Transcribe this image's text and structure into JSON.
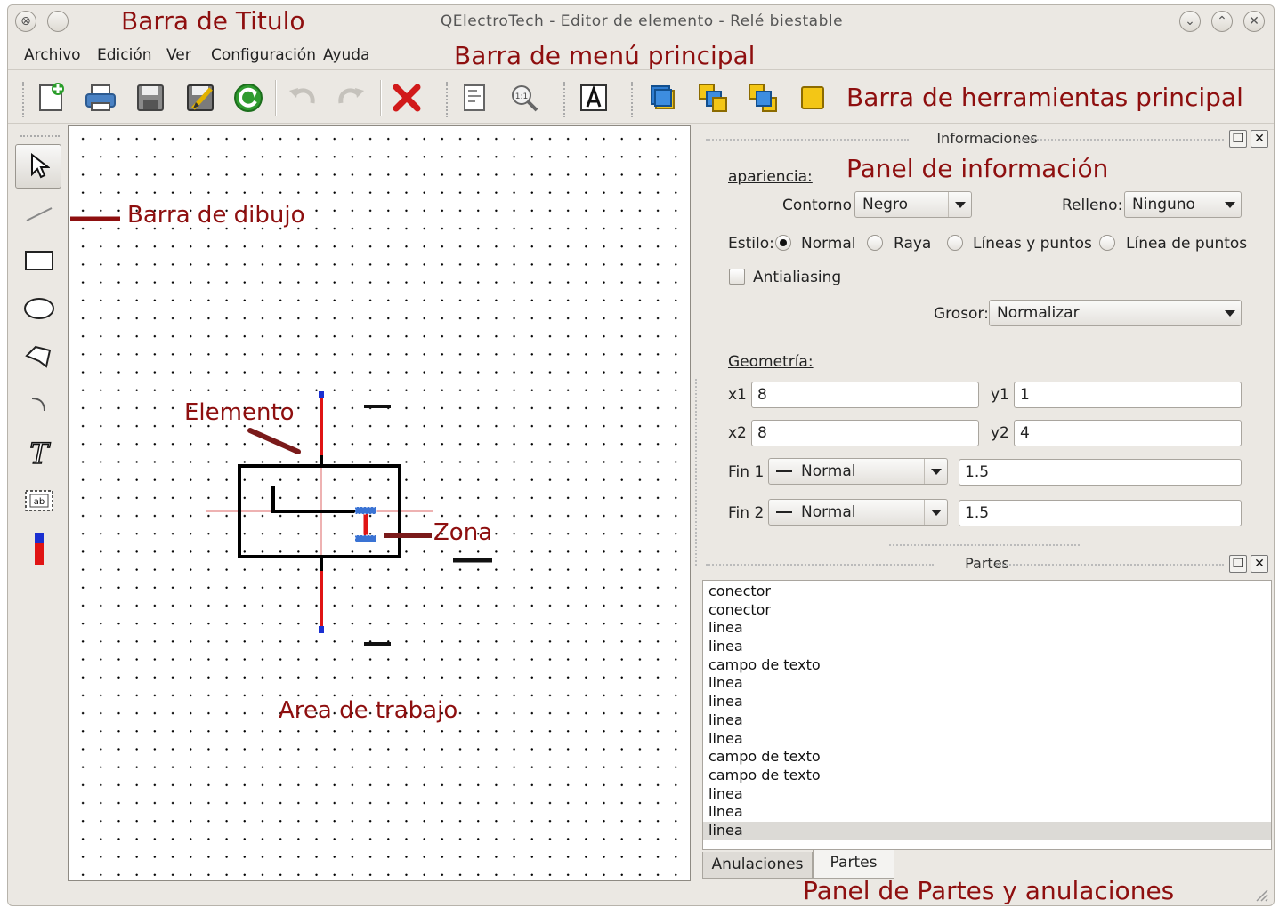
{
  "window": {
    "title": "QElectroTech - Editor de elemento - Relé biestable"
  },
  "annotations": {
    "title_bar": "Barra de Titulo",
    "menu_bar": "Barra de menú principal",
    "toolbar": "Barra de herramientas principal",
    "info_panel": "Panel de información",
    "draw_bar": "Barra de dibujo",
    "element": "Elemento",
    "zone": "Zona",
    "work_area": "Area de trabajo",
    "parts_panel": "Panel de Partes y anulaciones"
  },
  "menu": [
    "Archivo",
    "Edición",
    "Ver",
    "Configuración",
    "Ayuda"
  ],
  "toolbar_icons": [
    "new-icon",
    "print-icon",
    "save-icon",
    "save-as-icon",
    "reload-icon",
    "undo-icon",
    "redo-icon",
    "delete-icon",
    "properties-icon",
    "zoom-icon",
    "text-icon",
    "bring-front-icon",
    "raise-icon",
    "lower-icon",
    "send-back-icon"
  ],
  "draw_tools": [
    "pointer-icon",
    "line-icon",
    "rectangle-icon",
    "ellipse-icon",
    "polygon-icon",
    "arc-icon",
    "text-tool-icon",
    "textfield-icon",
    "terminal-icon"
  ],
  "info": {
    "dock_title": "Informaciones",
    "appearance_label": "apariencia:",
    "contour_label": "Contorno:",
    "contour_value": "Negro",
    "fill_label": "Relleno:",
    "fill_value": "Ninguno",
    "style_label": "Estilo:",
    "style_options": [
      "Normal",
      "Raya",
      "Líneas y puntos",
      "Línea de puntos"
    ],
    "style_selected": "Normal",
    "antialiasing_label": "Antialiasing",
    "antialiasing_checked": false,
    "weight_label": "Grosor:",
    "weight_value": "Normalizar",
    "geometry_label": "Geometría:",
    "x1_label": "x1",
    "x1": "8",
    "y1_label": "y1",
    "y1": "1",
    "x2_label": "x2",
    "x2": "8",
    "y2_label": "y2",
    "y2": "4",
    "end1_label": "Fin 1",
    "end1_style": "Normal",
    "end1_size": "1.5",
    "end2_label": "Fin 2",
    "end2_style": "Normal",
    "end2_size": "1.5"
  },
  "parts": {
    "dock_title": "Partes",
    "items": [
      "conector",
      "conector",
      "linea",
      "linea",
      "campo de texto",
      "linea",
      "linea",
      "linea",
      "linea",
      "campo de texto",
      "campo de texto",
      "linea",
      "linea",
      "linea"
    ],
    "selected_index": 13,
    "tabs": [
      "Anulaciones",
      "Partes"
    ],
    "active_tab": "Partes"
  }
}
